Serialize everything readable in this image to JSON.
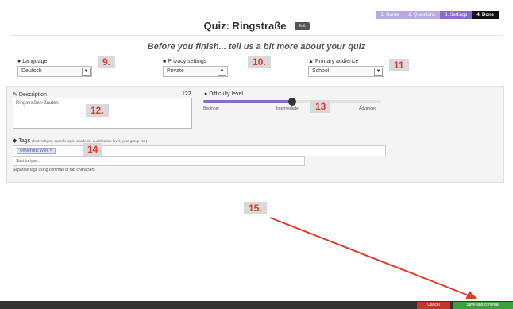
{
  "stepbar": {
    "steps": [
      {
        "label": "1. Name"
      },
      {
        "label": "2. Questions"
      },
      {
        "label": "3. Settings"
      },
      {
        "label": "4. Done"
      }
    ]
  },
  "header": {
    "title": "Quiz: Ringstraße",
    "edit_label": "Edit"
  },
  "intro": {
    "text": "Before you finish... tell us a bit more about your quiz"
  },
  "fields": {
    "language": {
      "label": "Language",
      "value": "Deutsch",
      "badge": "9."
    },
    "privacy": {
      "label": "Privacy settings",
      "value": "Private",
      "badge": "10."
    },
    "audience": {
      "label": "Primary audience",
      "value": "School",
      "badge": "11"
    }
  },
  "description": {
    "label": "Description",
    "counter": "122",
    "value": "Ringstraßen-Bauten",
    "badge": "12."
  },
  "difficulty": {
    "label": "Difficulty level",
    "ticks": [
      "Beginner",
      "Intermediate",
      "Advanced"
    ],
    "level": 0.5,
    "badge": "13"
  },
  "tags": {
    "label": "Tags",
    "hint": "(hint: subject, specific topic, academic qualification level, year group etc.)",
    "chips": [
      "Universität Wien ×"
    ],
    "placeholder": "Start to type...",
    "help": "Separate tags using commas or tab characters",
    "badge": "14"
  },
  "annotation": {
    "badge": "15."
  },
  "footer": {
    "cancel_label": "Cancel",
    "save_label": "Save and continue"
  },
  "colors": {
    "accent": "#8a6ad0",
    "annotation": "#e03a2f",
    "save": "#3b9f3b",
    "cancel": "#c0392b"
  }
}
